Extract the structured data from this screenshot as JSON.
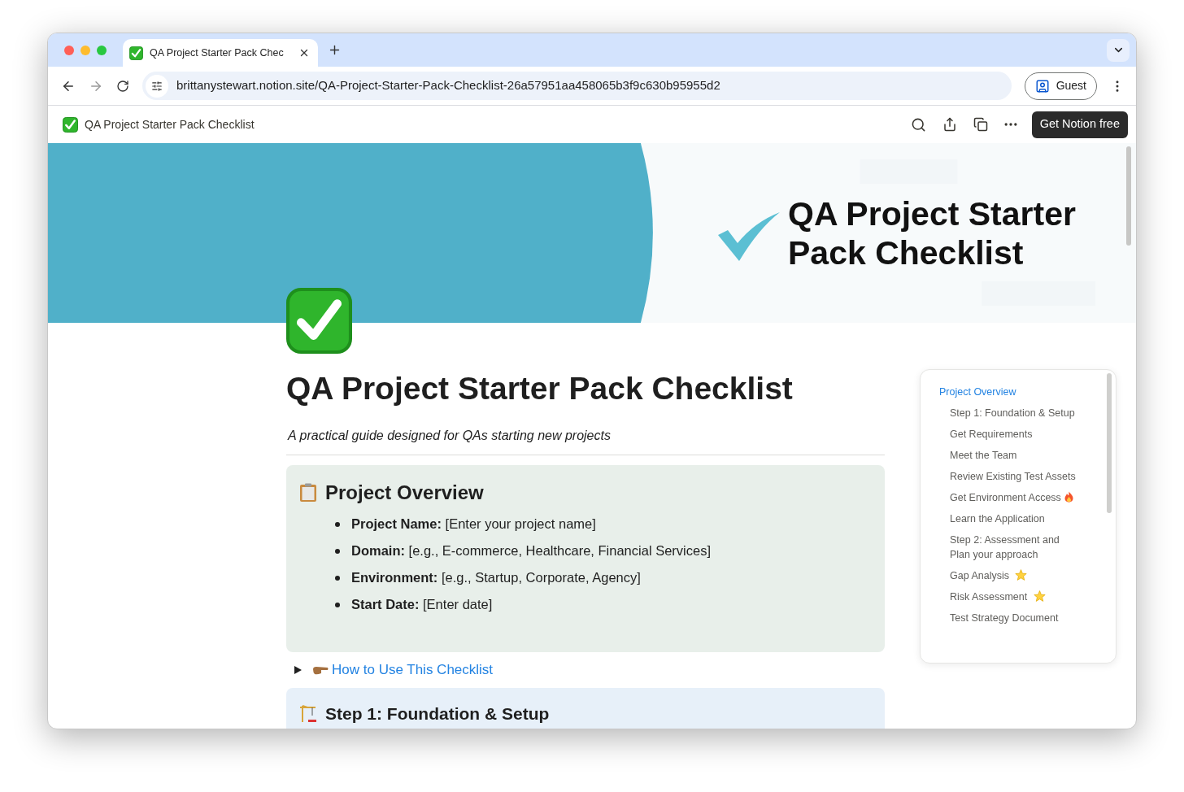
{
  "browser": {
    "tabs": [
      {
        "title": "QA Project Starter Pack Chec",
        "selected": true
      }
    ],
    "address": "brittanystewart.notion.site/QA-Project-Starter-Pack-Checklist-26a57951aa458065b3f9c630b95955d2",
    "profile": "Guest"
  },
  "topbar": {
    "title": "QA Project Starter Pack Checklist",
    "button": "Get Notion free"
  },
  "cover": {
    "lines": [
      "QA Project Starter",
      "Pack Checklist"
    ]
  },
  "page": {
    "title": "QA Project Starter Pack Checklist",
    "subtitle": "A practical guide designed for QAs starting new projects",
    "overview": {
      "heading": "Project Overview",
      "items": [
        {
          "label": "Project Name:",
          "value": "[Enter your project name]"
        },
        {
          "label": "Domain:",
          "value": "[e.g., E-commerce, Healthcare, Financial Services]"
        },
        {
          "label": "Environment:",
          "value": "[e.g., Startup, Corporate, Agency]"
        },
        {
          "label": "Start Date:",
          "value": "[Enter date]"
        }
      ]
    },
    "toggle": {
      "label": "How to Use This Checklist",
      "expanded": false
    },
    "step": {
      "heading": "Step 1: Foundation & Setup"
    }
  },
  "toc": {
    "items": [
      {
        "text": "Project Overview",
        "selected": true,
        "children": [
          {
            "text": "Step 1: Foundation & Setup",
            "selected": false
          },
          {
            "text": "Get Requirements",
            "selected": false
          },
          {
            "text": "Meet the Team",
            "selected": false
          },
          {
            "text": "Review Existing Test Assets",
            "selected": false
          },
          {
            "text": "Get Environment Access",
            "selected": false,
            "kind": "fire"
          },
          {
            "text": "Learn the Application",
            "selected": false
          },
          {
            "text": "Step 2: Assessment and Plan your approach",
            "selected": false
          },
          {
            "text": "Gap Analysis",
            "selected": false,
            "kind": "star"
          },
          {
            "text": "Risk Assessment",
            "selected": false,
            "kind": "star"
          },
          {
            "text": "Test Strategy Document",
            "selected": false
          }
        ]
      }
    ]
  }
}
